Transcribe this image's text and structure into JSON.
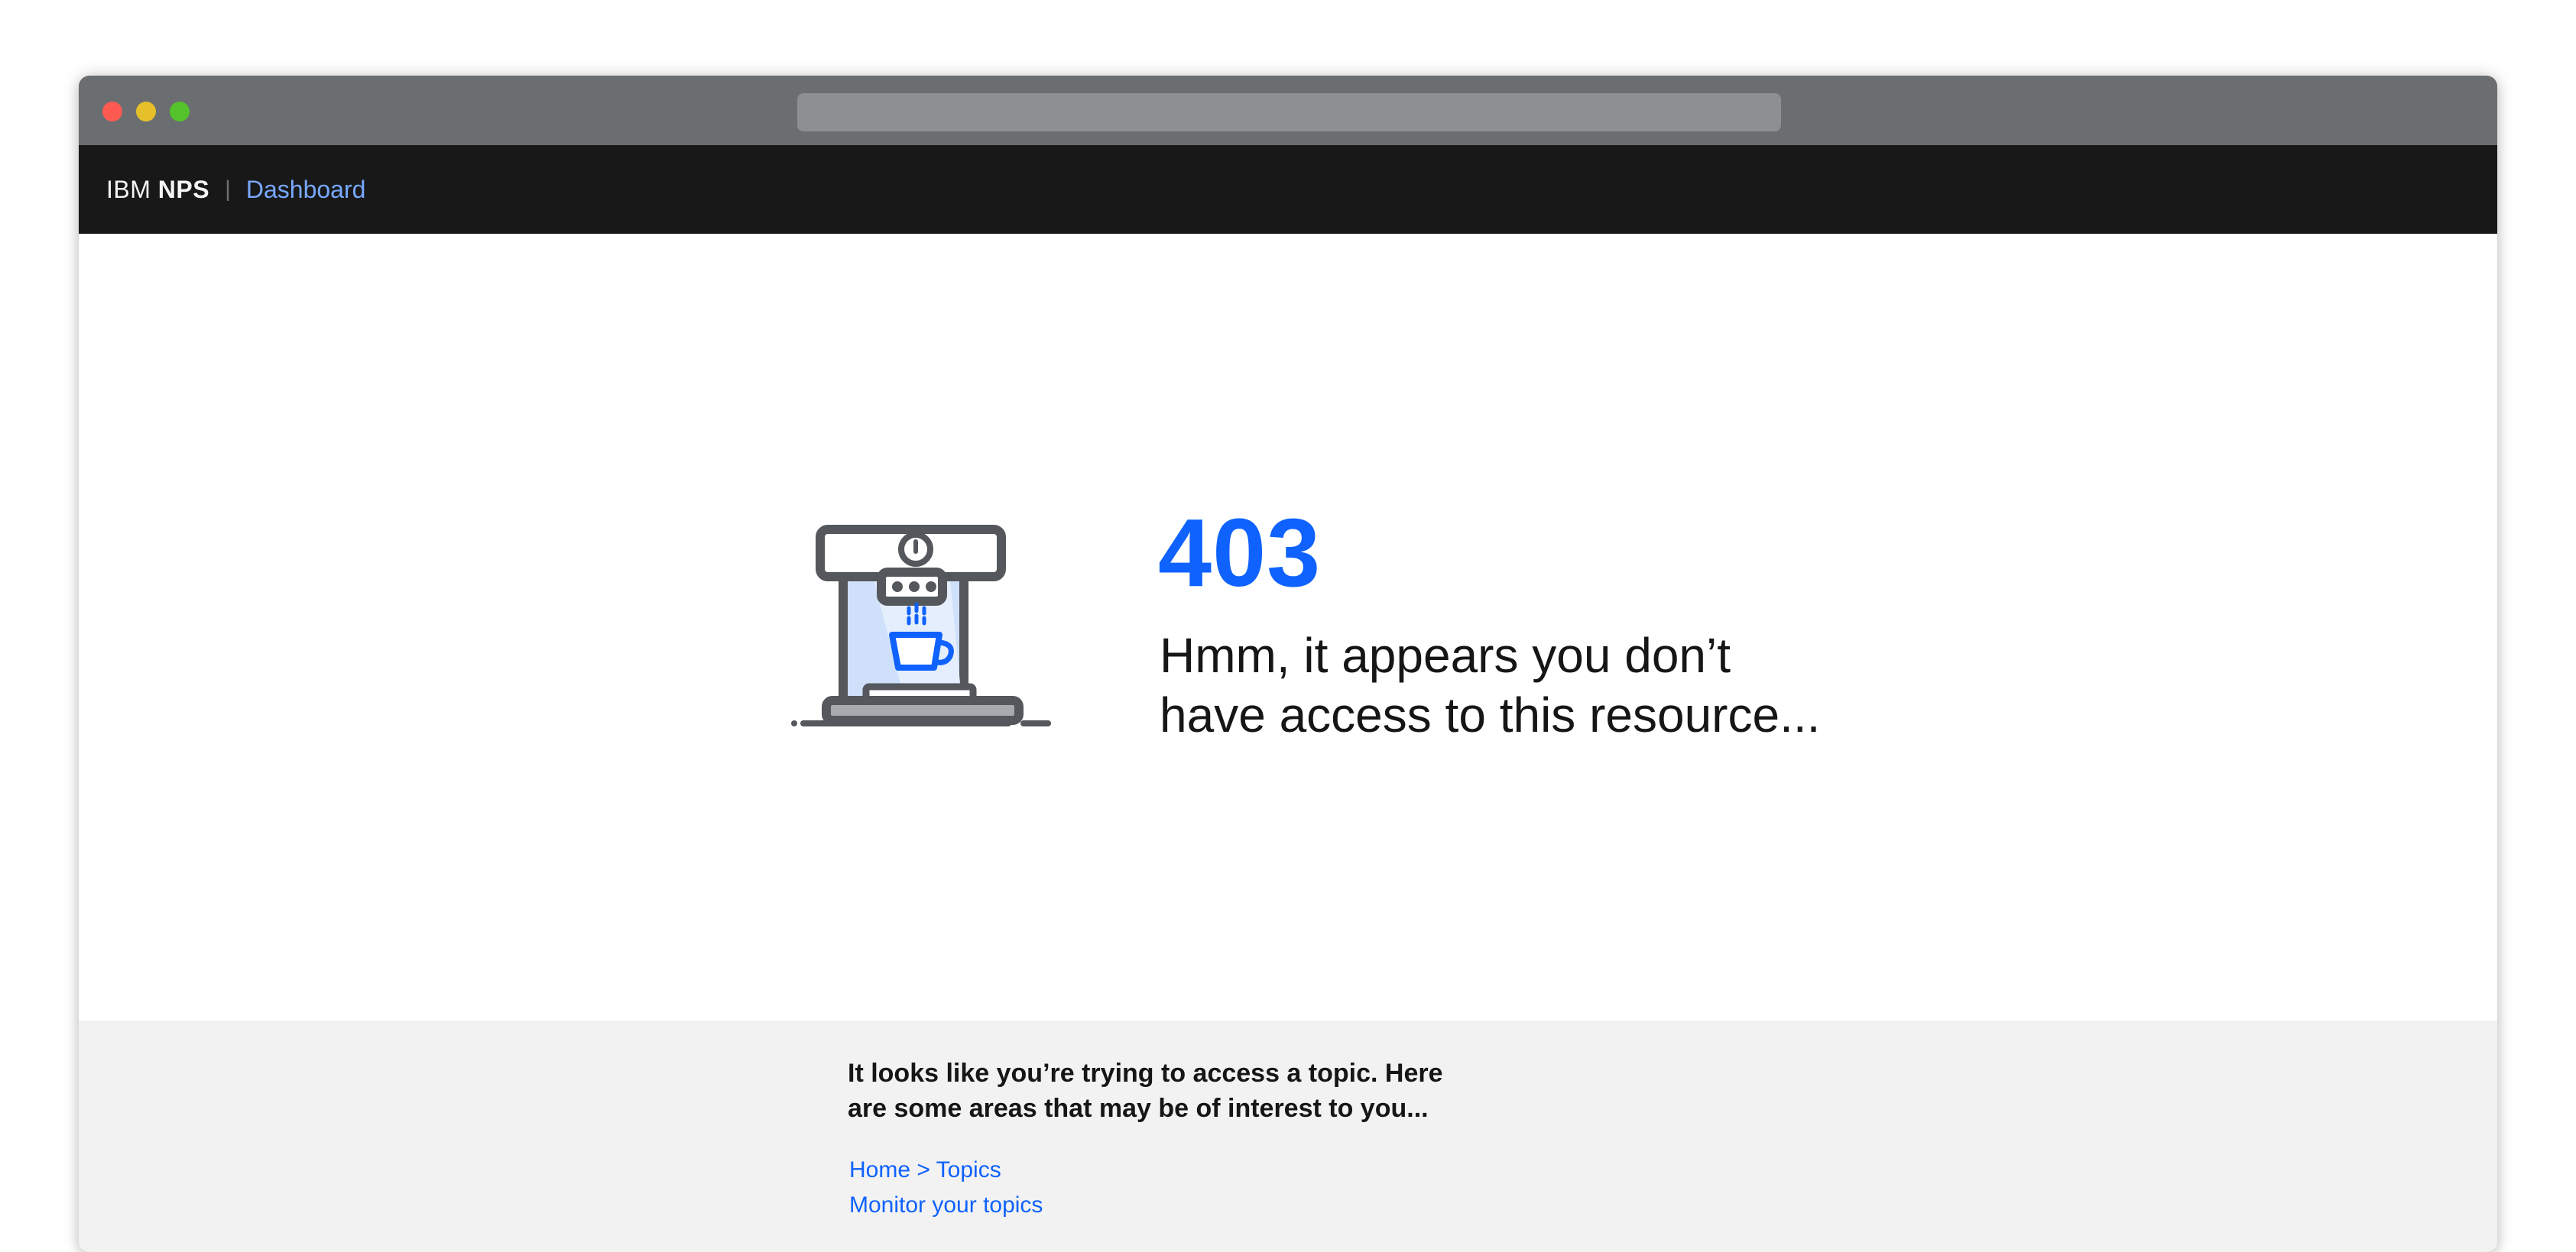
{
  "nav": {
    "brand_prefix": "IBM",
    "brand_bold": "NPS",
    "divider": "|",
    "link": "Dashboard"
  },
  "error": {
    "code": "403",
    "line1": "Hmm, it appears you don’t",
    "line2": "have access to this resource..."
  },
  "suggestions": {
    "heading_line1": "It looks like you’re trying to access a topic. Here",
    "heading_line2": "are some areas that may be of interest to you...",
    "links": [
      "Home > Topics",
      "Monitor your topics"
    ]
  },
  "icons": {
    "illustration": "coffee-machine-icon"
  },
  "colors": {
    "accent": "#0f62fe",
    "nav_bg": "#181818",
    "nav_link": "#78a9ff",
    "lower_bg": "#f2f2f2"
  }
}
